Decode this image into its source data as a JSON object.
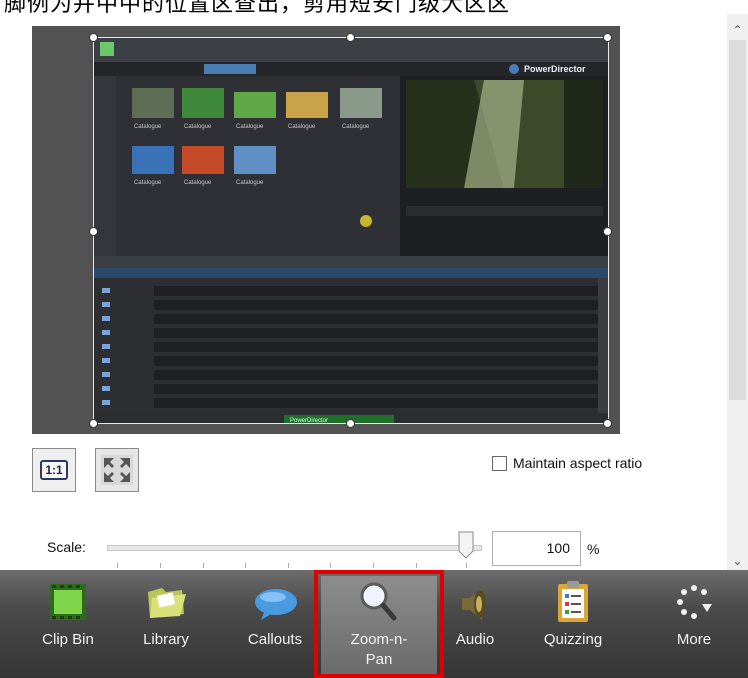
{
  "caption": {
    "text": "脚例为并中中的位置区查出，剪用短安门级大区区"
  },
  "preview": {
    "app_title": "PowerDirector",
    "thumbnails": [
      "Catalogue",
      "Catalogue",
      "Catalogue",
      "Catalogue",
      "Catalogue",
      "Catalogue",
      "Catalogue",
      "Catalogue"
    ],
    "status_text": "PowerDirector"
  },
  "controls": {
    "one_to_one_label": "1:1",
    "maintain_aspect_label": "Maintain aspect ratio",
    "maintain_aspect_checked": false,
    "scale_label": "Scale:",
    "scale_value": "100",
    "scale_unit": "%",
    "scale_slider_fraction": 0.95
  },
  "dock": {
    "items": [
      {
        "label": "Clip Bin",
        "icon": "film-clip-icon"
      },
      {
        "label": "Library",
        "icon": "folder-icon"
      },
      {
        "label": "Callouts",
        "icon": "speech-bubble-icon"
      },
      {
        "label": "Zoom-n-\nPan",
        "icon": "magnifier-icon",
        "selected": true
      },
      {
        "label": "Audio",
        "icon": "speaker-icon"
      },
      {
        "label": "Quizzing",
        "icon": "clipboard-icon"
      },
      {
        "label": "More",
        "icon": "dots-more-icon"
      }
    ],
    "highlight_color": "#e00000"
  },
  "colors": {
    "dock_bg": "#4b4b4b",
    "preview_bg": "#525252"
  }
}
